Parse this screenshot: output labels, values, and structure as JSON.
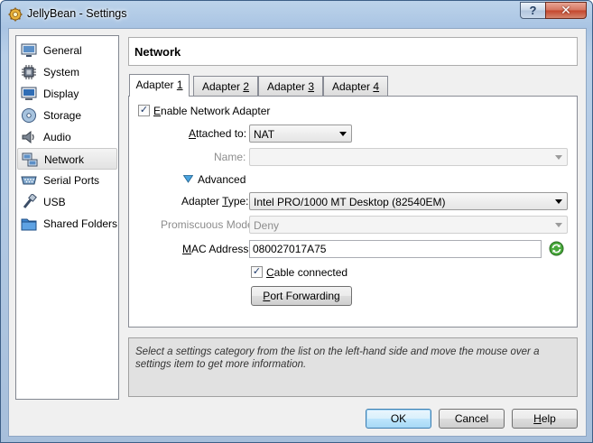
{
  "window": {
    "title": "JellyBean - Settings",
    "help_glyph": "?",
    "close_glyph": "✕"
  },
  "sidebar": {
    "items": [
      {
        "label": "General",
        "icon": "general-icon"
      },
      {
        "label": "System",
        "icon": "system-icon"
      },
      {
        "label": "Display",
        "icon": "display-icon"
      },
      {
        "label": "Storage",
        "icon": "storage-icon"
      },
      {
        "label": "Audio",
        "icon": "audio-icon"
      },
      {
        "label": "Network",
        "icon": "network-icon",
        "selected": true
      },
      {
        "label": "Serial Ports",
        "icon": "serial-ports-icon"
      },
      {
        "label": "USB",
        "icon": "usb-icon"
      },
      {
        "label": "Shared Folders",
        "icon": "shared-folders-icon"
      }
    ]
  },
  "header": {
    "title": "Network"
  },
  "tabs": [
    {
      "label": "Adapter ",
      "num": "1",
      "active": true
    },
    {
      "label": "Adapter ",
      "num": "2"
    },
    {
      "label": "Adapter ",
      "num": "3"
    },
    {
      "label": "Adapter ",
      "num": "4"
    }
  ],
  "adapter": {
    "enable_label_pre": "",
    "enable_label_u": "E",
    "enable_label_post": "nable Network Adapter",
    "enable_checked": true,
    "attached_label_pre": "",
    "attached_label_u": "A",
    "attached_label_post": "ttached to:",
    "attached_value": "NAT",
    "name_label": "Name:",
    "name_value": "",
    "advanced_label": "Advanced",
    "adapter_type_label_pre": "Adapter ",
    "adapter_type_label_u": "T",
    "adapter_type_label_post": "ype:",
    "adapter_type_value": "Intel PRO/1000 MT Desktop (82540EM)",
    "promiscuous_label": "Promiscuous Mode:",
    "promiscuous_value": "Deny",
    "mac_label_pre": "",
    "mac_label_u": "M",
    "mac_label_post": "AC Address:",
    "mac_value": "080027017A75",
    "cable_label_pre": "",
    "cable_label_u": "C",
    "cable_label_post": "able connected",
    "cable_checked": true,
    "port_forwarding_label_pre": "",
    "port_forwarding_label_u": "P",
    "port_forwarding_label_post": "ort Forwarding",
    "check_glyph": "✓"
  },
  "info": {
    "text": "Select a settings category from the list on the left-hand side and move the mouse over a settings item to get more information."
  },
  "buttons": {
    "ok": "OK",
    "cancel": "Cancel",
    "help_pre": "",
    "help_u": "H",
    "help_post": "elp"
  }
}
